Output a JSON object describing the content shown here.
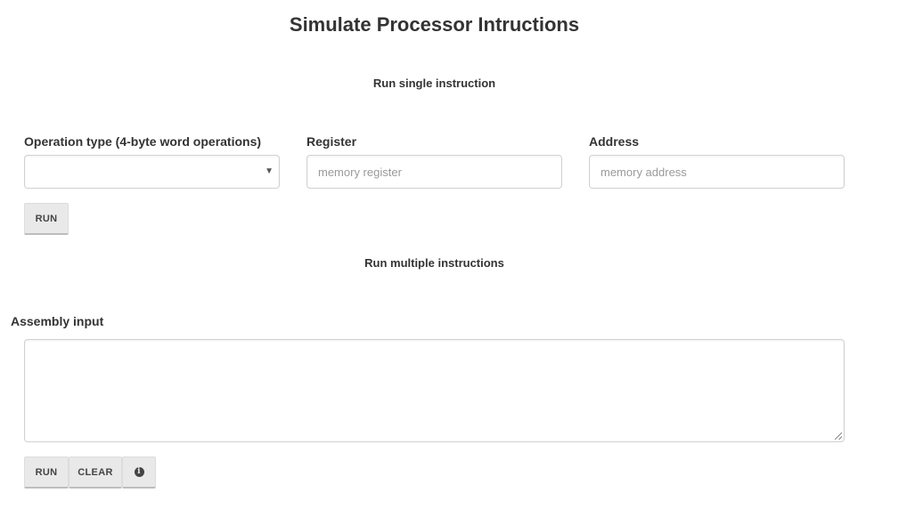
{
  "page": {
    "title": "Simulate Processor Intructions"
  },
  "single": {
    "heading": "Run single instruction",
    "operation_label": "Operation type (4-byte word operations)",
    "operation_value": "",
    "register_label": "Register",
    "register_placeholder": "memory register",
    "address_label": "Address",
    "address_placeholder": "memory address",
    "run_label": "RUN"
  },
  "multiple": {
    "heading": "Run multiple instructions",
    "assembly_label": "Assembly input",
    "assembly_value": "",
    "run_label": "RUN",
    "clear_label": "CLEAR",
    "info_icon": "info-circle-icon",
    "info_glyph": "i"
  }
}
